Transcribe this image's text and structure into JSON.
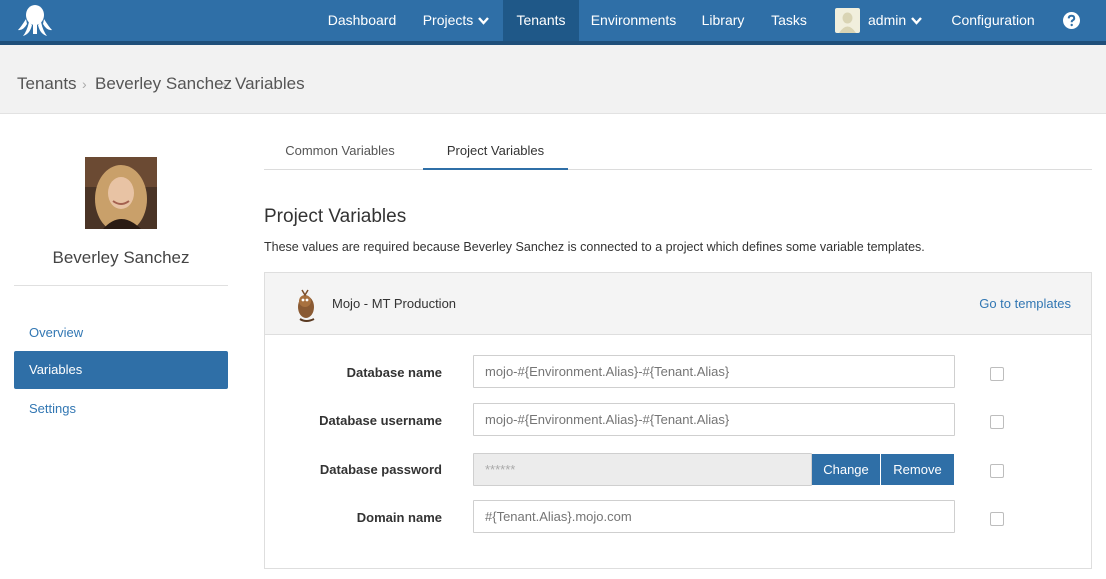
{
  "nav": {
    "items": [
      {
        "label": "Dashboard"
      },
      {
        "label": "Projects"
      },
      {
        "label": "Tenants"
      },
      {
        "label": "Environments"
      },
      {
        "label": "Library"
      },
      {
        "label": "Tasks"
      },
      {
        "label": "admin"
      },
      {
        "label": "Configuration"
      }
    ],
    "help_icon": "question-circle-icon"
  },
  "breadcrumb": [
    "Tenants",
    "Beverley Sanchez",
    "Variables"
  ],
  "sidebar": {
    "name": "Beverley Sanchez",
    "links": [
      {
        "label": "Overview"
      },
      {
        "label": "Variables"
      },
      {
        "label": "Settings"
      }
    ]
  },
  "tabs": [
    {
      "label": "Common Variables"
    },
    {
      "label": "Project Variables"
    }
  ],
  "section": {
    "title": "Project Variables",
    "description": "These values are required because Beverley Sanchez is connected to a project which defines some variable templates."
  },
  "project": {
    "name": "Mojo - MT Production",
    "goto_label": "Go to templates"
  },
  "variables": [
    {
      "label": "Database name",
      "placeholder": "mojo-#{Environment.Alias}-#{Tenant.Alias}"
    },
    {
      "label": "Database username",
      "placeholder": "mojo-#{Environment.Alias}-#{Tenant.Alias}"
    },
    {
      "label": "Database password",
      "value": "******",
      "change_label": "Change",
      "remove_label": "Remove"
    },
    {
      "label": "Domain name",
      "placeholder": "#{Tenant.Alias}.mojo.com"
    }
  ],
  "colors": {
    "brand": "#2f6fa7",
    "link": "#3277b3"
  }
}
